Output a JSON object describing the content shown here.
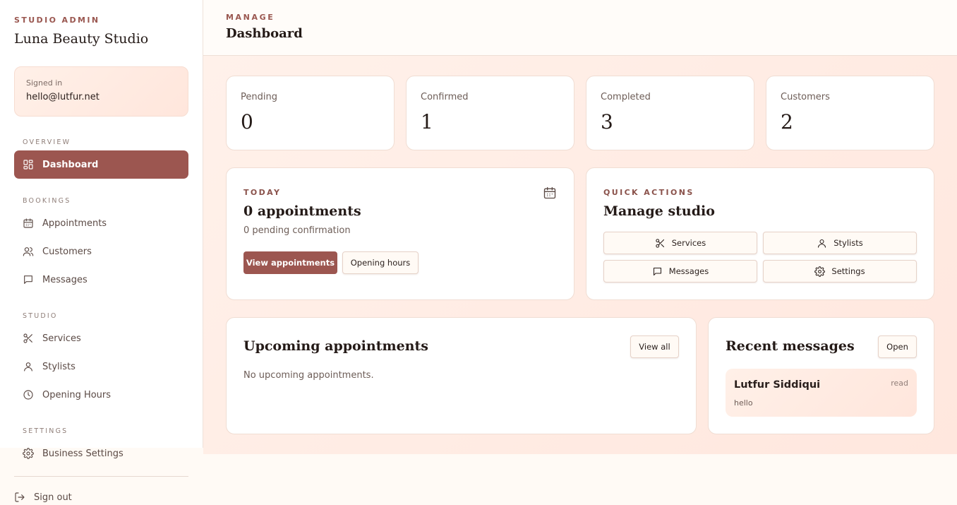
{
  "sidebar": {
    "kicker": "STUDIO ADMIN",
    "title": "Luna Beauty Studio",
    "signed_label": "Signed in",
    "signed_email": "hello@lutfur.net",
    "sections": {
      "overview": "OVERVIEW",
      "bookings": "BOOKINGS",
      "studio": "STUDIO",
      "settings": "SETTINGS"
    },
    "items": {
      "dashboard": "Dashboard",
      "appointments": "Appointments",
      "customers": "Customers",
      "messages": "Messages",
      "services": "Services",
      "stylists": "Stylists",
      "opening_hours": "Opening Hours",
      "business_settings": "Business Settings"
    },
    "sign_out": "Sign out"
  },
  "header": {
    "kicker": "MANAGE",
    "title": "Dashboard"
  },
  "stats": [
    {
      "label": "Pending",
      "value": "0"
    },
    {
      "label": "Confirmed",
      "value": "1"
    },
    {
      "label": "Completed",
      "value": "3"
    },
    {
      "label": "Customers",
      "value": "2"
    }
  ],
  "today": {
    "kicker": "TODAY",
    "title": "0 appointments",
    "subtitle": "0 pending confirmation",
    "view_appointments": "View appointments",
    "opening_hours": "Opening hours"
  },
  "quick_actions": {
    "kicker": "QUICK ACTIONS",
    "title": "Manage studio",
    "services": "Services",
    "stylists": "Stylists",
    "messages": "Messages",
    "settings": "Settings"
  },
  "upcoming": {
    "title": "Upcoming appointments",
    "view_all": "View all",
    "empty": "No upcoming appointments."
  },
  "recent_messages": {
    "title": "Recent messages",
    "open": "Open",
    "items": [
      {
        "name": "Lutfur Siddiqui",
        "status": "read",
        "preview": "hello"
      }
    ]
  },
  "colors": {
    "accent": "#9c5650",
    "kicker": "#9a5750",
    "background": "#ffe9e0"
  },
  "icons": {
    "dashboard": "grid-icon",
    "appointments": "calendar-icon",
    "customers": "users-icon",
    "messages": "chat-icon",
    "services": "scissors-icon",
    "stylists": "user-icon",
    "opening_hours": "clock-icon",
    "business_settings": "gear-icon",
    "sign_out": "logout-icon"
  }
}
